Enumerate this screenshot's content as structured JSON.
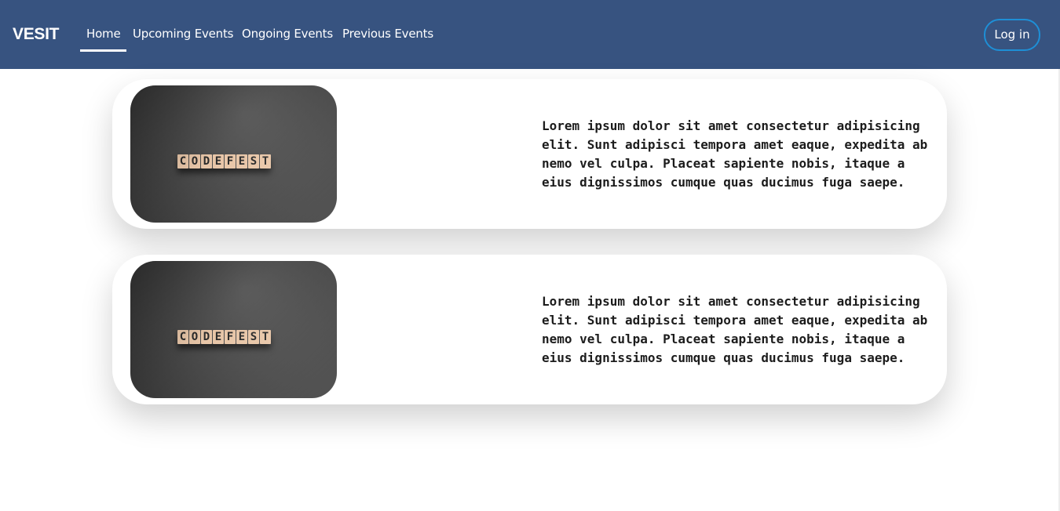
{
  "navbar": {
    "brand": "VESIT",
    "links": [
      "Home",
      "Upcoming Events",
      "Ongoing Events",
      "Previous Events"
    ],
    "active_link": "Home",
    "login_label": "Log in",
    "colors": {
      "background": "#375380",
      "login_border": "#1e8fd6"
    }
  },
  "events": [
    {
      "image_icon": "codefest-tiles-image",
      "image_letters": [
        "C",
        "O",
        "D",
        "E",
        "F",
        "E",
        "S",
        "T"
      ],
      "description": "Lorem ipsum dolor sit amet consectetur adipisicing elit. Sunt adipisci tempora amet eaque, expedita ab nemo vel culpa. Placeat sapiente nobis, itaque a eius dignissimos cumque quas ducimus fuga saepe."
    },
    {
      "image_icon": "codefest-tiles-image",
      "image_letters": [
        "C",
        "O",
        "D",
        "E",
        "F",
        "E",
        "S",
        "T"
      ],
      "description": "Lorem ipsum dolor sit amet consectetur adipisicing elit. Sunt adipisci tempora amet eaque, expedita ab nemo vel culpa. Placeat sapiente nobis, itaque a eius dignissimos cumque quas ducimus fuga saepe."
    }
  ]
}
